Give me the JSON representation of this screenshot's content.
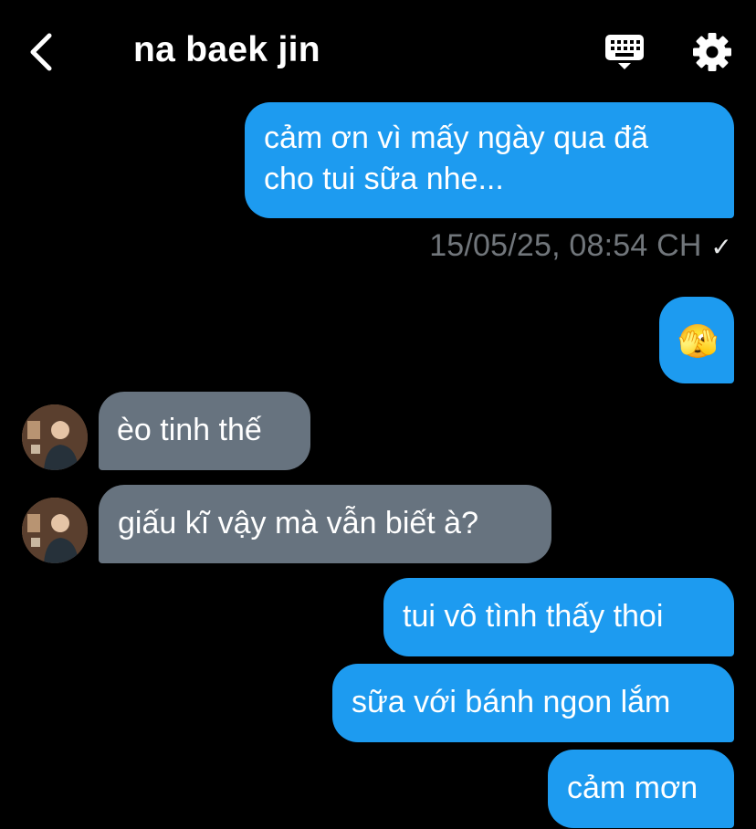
{
  "header": {
    "title": "na baek jin"
  },
  "messages": [
    {
      "direction": "out",
      "text_line1": "cảm ơn vì mấy ngày qua đã",
      "text_line2": "cho tui sữa nhe..."
    },
    {
      "direction": "out",
      "emoji": "🫣"
    },
    {
      "direction": "in",
      "text": "èo tinh thế"
    },
    {
      "direction": "in",
      "text": "giấu kĩ vậy mà vẫn biết à?"
    },
    {
      "direction": "out",
      "text": "tui vô tình thấy thoi"
    },
    {
      "direction": "out",
      "text": "sữa với bánh ngon lắm"
    },
    {
      "direction": "out",
      "text": "cảm mơn"
    }
  ],
  "timestamp": "15/05/25, 08:54 CH",
  "read_receipt": "✓",
  "colors": {
    "background": "#000000",
    "outgoing_bubble": "#1d9bf0",
    "incoming_bubble": "#67737f",
    "timestamp": "#71767b"
  },
  "icons": [
    "back-icon",
    "keyboard-icon",
    "gear-icon",
    "face-with-peeking-eye-emoji",
    "checkmark-icon"
  ]
}
